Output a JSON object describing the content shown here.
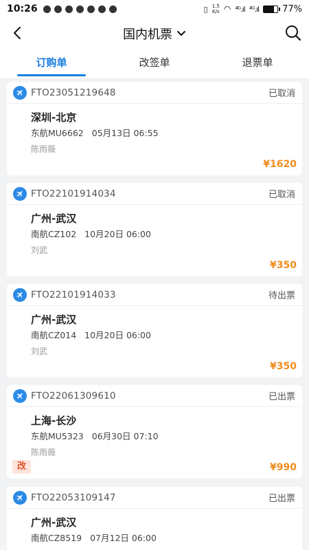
{
  "status_bar": {
    "time": "10:26",
    "net_speed_top": "1.5",
    "net_speed_bottom": "K/s",
    "signal1": "⁴ᴳ.ıl",
    "signal2": "⁴ᴳ.ıl",
    "battery_percent": 77,
    "battery_label": "77%"
  },
  "header": {
    "title": "国内机票",
    "back_icon": "chevron-left-icon",
    "search_icon": "search-icon"
  },
  "tabs": [
    {
      "label": "订购单",
      "active": true
    },
    {
      "label": "改签单",
      "active": false
    },
    {
      "label": "退票单",
      "active": false
    }
  ],
  "orders": [
    {
      "order_no": "FTO23051219648",
      "status": "已取消",
      "route": "深圳-北京",
      "flight_no": "东航MU6662",
      "datetime": "05月13日 06:55",
      "passenger": "陈雨薇",
      "price": "¥1620",
      "tag": ""
    },
    {
      "order_no": "FTO22101914034",
      "status": "已取消",
      "route": "广州-武汉",
      "flight_no": "南航CZ102",
      "datetime": "10月20日 06:00",
      "passenger": "刘武",
      "price": "¥350",
      "tag": ""
    },
    {
      "order_no": "FTO22101914033",
      "status": "待出票",
      "route": "广州-武汉",
      "flight_no": "南航CZ014",
      "datetime": "10月20日 06:00",
      "passenger": "刘武",
      "price": "¥350",
      "tag": ""
    },
    {
      "order_no": "FTO22061309610",
      "status": "已出票",
      "route": "上海-长沙",
      "flight_no": "东航MU5323",
      "datetime": "06月30日 07:10",
      "passenger": "陈雨薇",
      "price": "¥990",
      "tag": "改"
    },
    {
      "order_no": "FTO22053109147",
      "status": "已出票",
      "route": "广州-武汉",
      "flight_no": "南航CZ8519",
      "datetime": "07月12日 06:00",
      "passenger": "",
      "price": "",
      "tag": ""
    }
  ],
  "colors": {
    "accent": "#1a7ee0",
    "price": "#f08c1e",
    "tag": "#e5532b"
  }
}
